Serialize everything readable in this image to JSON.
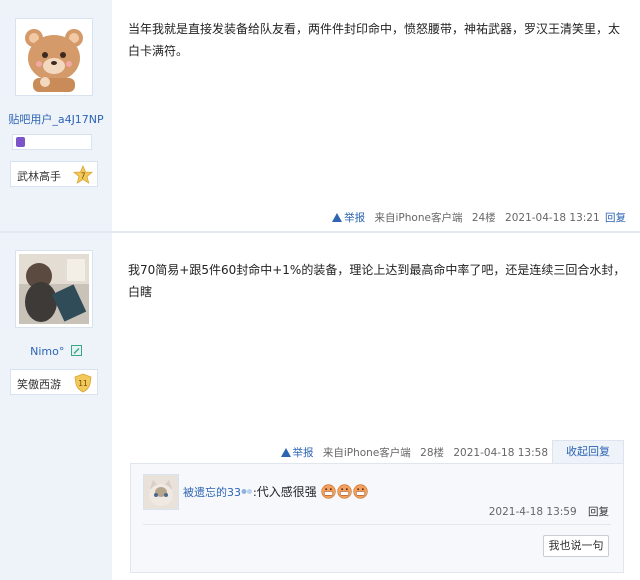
{
  "posts": [
    {
      "username": "贴吧用户_a4J17NP",
      "level_title": "武林高手",
      "level_number": "7",
      "content": "当年我就是直接发装备给队友看，两件件封印命中，愤怒腰带，神祐武器，罗汉王清笑里，太白卡满符。",
      "report": "举报",
      "source": "来自iPhone客户端",
      "floor": "24楼",
      "time": "2021-04-18 13:21",
      "reply": "回复"
    },
    {
      "username": "Nimo°",
      "level_title": "笑傲西游",
      "level_number": "11",
      "content": "我70简易+跟5件60封命中+1%的装备，理论上达到最高命中率了吧，还是连续三回合水封，白瞎",
      "report": "举报",
      "source": "来自iPhone客户端",
      "floor": "28楼",
      "time": "2021-04-18 13:58",
      "fold_reply": "收起回复",
      "sub_reply": {
        "username": "被遗忘的33",
        "separator": ":",
        "text": "代入感很强",
        "time": "2021-4-18 13:59",
        "reply": "回复"
      },
      "say_button": "我也说一句"
    }
  ],
  "colors": {
    "link": "#2d64b3",
    "sidebar_bg": "#eef3fa"
  }
}
